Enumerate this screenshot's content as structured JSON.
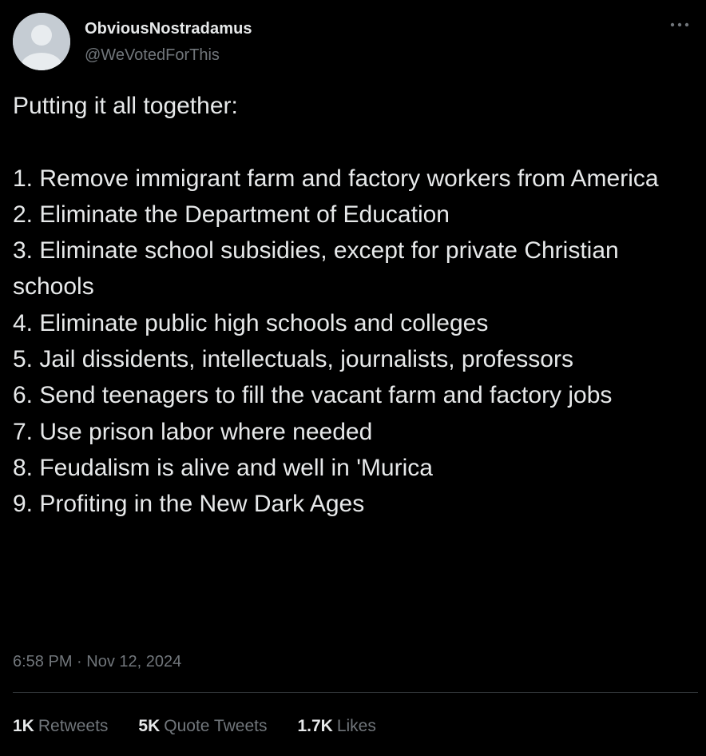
{
  "author": {
    "display_name": "ObviousNostradamus",
    "handle": "@WeVotedForThis",
    "avatar_icon": "default-profile-icon"
  },
  "more_icon": "more-dots-icon",
  "tweet": {
    "intro": "Putting it all together:",
    "lines": [
      "1. Remove immigrant farm and factory workers from America",
      "2. Eliminate the Department of Education",
      "3. Eliminate school subsidies, except for private Christian schools",
      "4. Eliminate public high schools and colleges",
      "5. Jail dissidents, intellectuals, journalists, professors",
      "6. Send teenagers to fill the vacant farm and factory jobs",
      "7. Use prison labor where needed",
      "8. Feudalism is alive and well in 'Murica",
      "9. Profiting in the New Dark Ages"
    ]
  },
  "timestamp": "6:58 PM · Nov 12, 2024",
  "stats": {
    "retweets_count": "1K",
    "retweets_label": "Retweets",
    "quotes_count": "5K",
    "quotes_label": "Quote Tweets",
    "likes_count": "1.7K",
    "likes_label": "Likes"
  },
  "colors": {
    "background": "#000000",
    "text_primary": "#e7e9ea",
    "text_secondary": "#71767b",
    "divider": "#2f3336",
    "avatar_bg": "#c5ccd3",
    "avatar_fg": "#e8ecef"
  }
}
